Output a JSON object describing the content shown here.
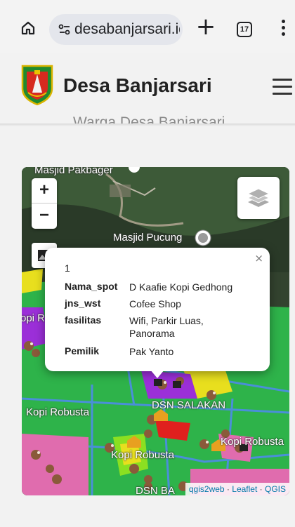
{
  "browser": {
    "url": "desabanjarsari.id",
    "tab_count": "17",
    "home_icon": "home-icon",
    "site_info_icon": "tune-icon",
    "new_tab_icon": "plus-icon",
    "menu_icon": "more-vert-icon"
  },
  "site": {
    "title": "Desa Banjarsari",
    "subtitle_clipped": "Warga Desa Banjarsari",
    "menu_icon": "hamburger-icon"
  },
  "map": {
    "zoom_in": "+",
    "zoom_out": "−",
    "labels": {
      "masjid_top": "Masjid Pakbager",
      "masjid_pucung": "Masjid Pucung",
      "kopi_r_left": "opi R",
      "kopi_robusta_left": "Kopi Robusta",
      "dsn_salakan": "DSN SALAKAN",
      "kopi_robusta_right": "Kopi Robusta",
      "kopi_robusta_bottom": "Kopi Robusta",
      "dsn_bottom": "DSN BA"
    },
    "attribution": {
      "qgis2web": "qgis2web",
      "sep": "·",
      "leaflet": "Leaflet",
      "qgis": "QGIS"
    },
    "colors": {
      "green": "#2eb34a",
      "blue_border": "#4a8fd8",
      "pink": "#e06cae",
      "purple": "#9b2fd8",
      "yellow": "#e8df1e",
      "red": "#e0201e",
      "lime": "#8be021"
    }
  },
  "popup": {
    "close": "×",
    "id": "1",
    "rows": [
      {
        "key": "Nama_spot",
        "value": "D Kaafie Kopi Gedhong"
      },
      {
        "key": "jns_wst",
        "value": "Cofee Shop"
      },
      {
        "key": "fasilitas",
        "value": "Wifi, Parkir Luas, Panorama"
      },
      {
        "key": "Pemilik",
        "value": "Pak Yanto"
      }
    ]
  }
}
